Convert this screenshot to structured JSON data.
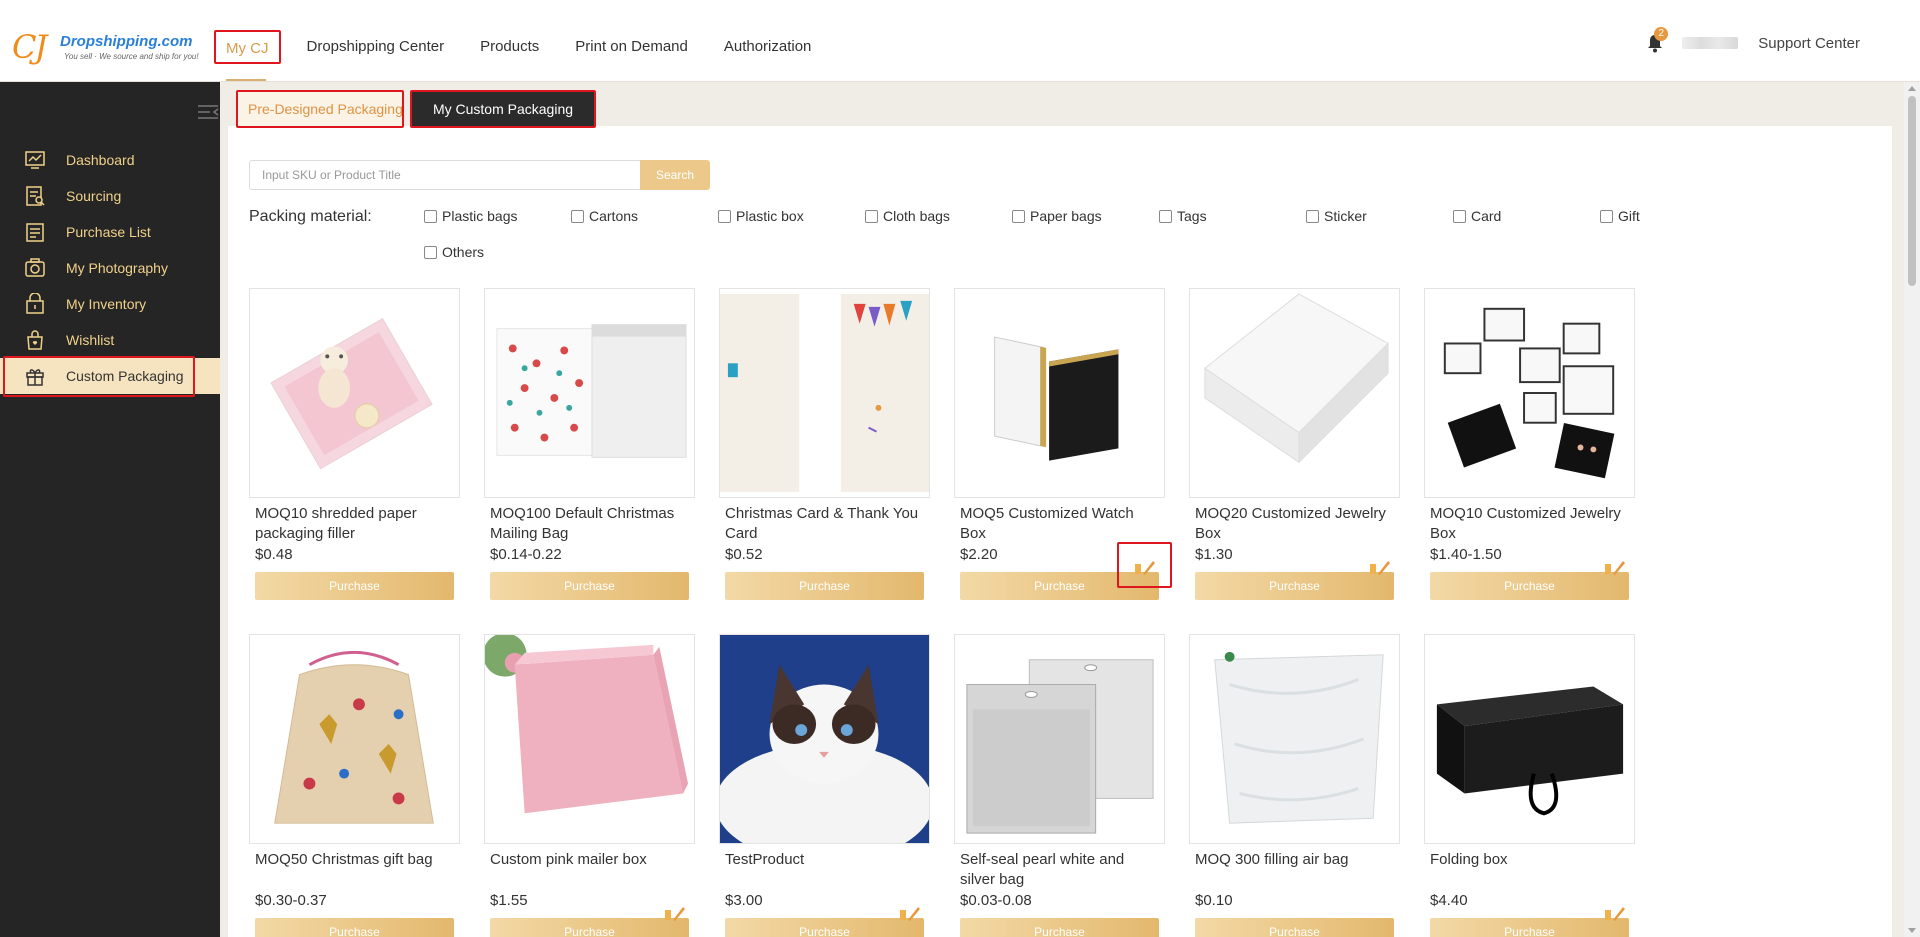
{
  "logo": {
    "mark": "CJ",
    "name": "Dropshipping.com",
    "tagline": "You sell · We source and ship for you!"
  },
  "nav": [
    {
      "label": "My CJ"
    },
    {
      "label": "Dropshipping Center"
    },
    {
      "label": "Products"
    },
    {
      "label": "Print on Demand"
    },
    {
      "label": "Authorization"
    }
  ],
  "header": {
    "notification_count": "2",
    "support_label": "Support Center"
  },
  "sidebar": {
    "items": [
      {
        "label": "Dashboard",
        "icon": "dashboard-icon"
      },
      {
        "label": "Sourcing",
        "icon": "sourcing-icon"
      },
      {
        "label": "Purchase List",
        "icon": "purchase-list-icon"
      },
      {
        "label": "My Photography",
        "icon": "camera-icon"
      },
      {
        "label": "My Inventory",
        "icon": "inventory-icon"
      },
      {
        "label": "Wishlist",
        "icon": "wishlist-icon"
      },
      {
        "label": "Custom Packaging",
        "icon": "gift-icon"
      }
    ]
  },
  "tabs": [
    {
      "label": "Pre-Designed Packaging"
    },
    {
      "label": "My Custom Packaging"
    }
  ],
  "search": {
    "placeholder": "Input SKU or Product Title",
    "button": "Search"
  },
  "filters": {
    "label": "Packing material:",
    "options": [
      "Plastic bags",
      "Cartons",
      "Plastic box",
      "Cloth bags",
      "Paper bags",
      "Tags",
      "Sticker",
      "Card",
      "Gift",
      "Others"
    ]
  },
  "products": [
    {
      "title": "MOQ10 shredded paper packaging filler",
      "price": "$0.48",
      "button": "Purchase",
      "editable": false
    },
    {
      "title": "MOQ100 Default Christmas Mailing Bag",
      "price": "$0.14-0.22",
      "button": "Purchase",
      "editable": false
    },
    {
      "title": "Christmas Card & Thank You Card",
      "price": "$0.52",
      "button": "Purchase",
      "editable": false
    },
    {
      "title": "MOQ5 Customized Watch Box",
      "price": "$2.20",
      "button": "Purchase",
      "editable": true
    },
    {
      "title": "MOQ20 Customized Jewelry Box",
      "price": "$1.30",
      "button": "Purchase",
      "editable": true
    },
    {
      "title": "MOQ10 Customized Jewelry Box",
      "price": "$1.40-1.50",
      "button": "Purchase",
      "editable": true
    },
    {
      "title": "MOQ50 Christmas gift bag",
      "price": "$0.30-0.37",
      "button": "Purchase",
      "editable": false
    },
    {
      "title": "Custom pink mailer box",
      "price": "$1.55",
      "button": "Purchase",
      "editable": true
    },
    {
      "title": "TestProduct",
      "price": "$3.00",
      "button": "Purchase",
      "editable": true
    },
    {
      "title": "Self-seal pearl white and silver bag",
      "price": "$0.03-0.08",
      "button": "Purchase",
      "editable": false
    },
    {
      "title": "MOQ 300 filling air bag",
      "price": "$0.10",
      "button": "Purchase",
      "editable": false
    },
    {
      "title": "Folding box",
      "price": "$4.40",
      "button": "Purchase",
      "editable": true
    }
  ],
  "colors": {
    "accent": "#e3b86d",
    "sidebar_bg": "#252525",
    "sidebar_text": "#f1d18a",
    "highlight_outline": "#e0161e"
  }
}
